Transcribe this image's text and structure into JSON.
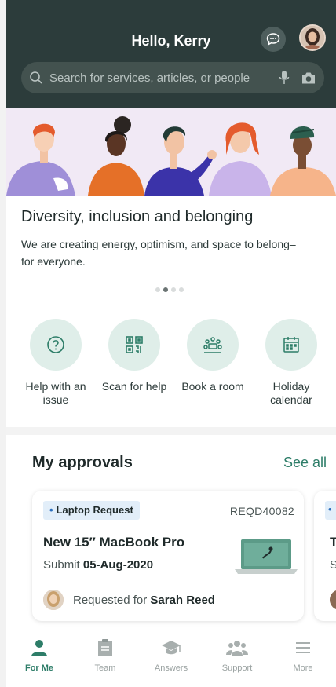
{
  "header": {
    "greeting": "Hello, Kerry",
    "chat_icon": "chat-bubble-icon",
    "profile_icon": "avatar"
  },
  "search": {
    "placeholder": "Search for services, articles, or people",
    "icons": [
      "search-icon",
      "microphone-icon",
      "camera-icon"
    ]
  },
  "banner": {
    "title": "Diversity, inclusion and belonging",
    "text": "We are creating energy, optimism, and space to belong–for everyone.",
    "dot_count": 4,
    "active_dot": 1
  },
  "quick_actions": [
    {
      "label": "Help with an issue",
      "icon": "help-circle-icon"
    },
    {
      "label": "Scan for help",
      "icon": "qr-code-icon"
    },
    {
      "label": "Book a room",
      "icon": "meeting-room-icon"
    },
    {
      "label": "Holiday calendar",
      "icon": "calendar-icon"
    }
  ],
  "approvals": {
    "title": "My approvals",
    "see_all": "See all",
    "cards": [
      {
        "tag": "Laptop Request",
        "id": "REQD40082",
        "title": "New 15″ MacBook Pro",
        "submit_label": "Submit",
        "submit_date": "05-Aug-2020",
        "requested_label": "Requested for",
        "requested_name": "Sarah Reed"
      },
      {
        "title_partial": "Th",
        "submit_partial": "Su"
      }
    ]
  },
  "bottom_nav": [
    {
      "label": "For Me",
      "icon": "person-icon",
      "active": true
    },
    {
      "label": "Team",
      "icon": "clipboard-icon",
      "active": false
    },
    {
      "label": "Answers",
      "icon": "graduation-cap-icon",
      "active": false
    },
    {
      "label": "Support",
      "icon": "people-group-icon",
      "active": false
    },
    {
      "label": "More",
      "icon": "menu-icon",
      "active": false
    }
  ],
  "colors": {
    "header_bg": "#2c3c3b",
    "accent": "#2d7d68",
    "action_circle": "#dfeee9",
    "tag_bg": "#e2eef9"
  }
}
